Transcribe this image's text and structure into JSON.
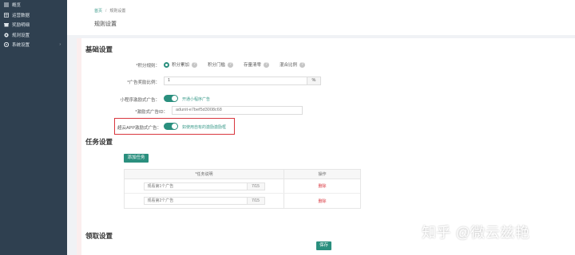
{
  "sidebar": {
    "items": [
      {
        "label": "概览",
        "icon": "list-icon"
      },
      {
        "label": "运营数据",
        "icon": "table-icon"
      },
      {
        "label": "奖励明细",
        "icon": "gift-icon"
      },
      {
        "label": "规则设置",
        "icon": "settings-icon"
      },
      {
        "label": "系统设置",
        "icon": "system-icon",
        "has_caret": true
      }
    ]
  },
  "breadcrumb": {
    "home": "首页",
    "separator": "/",
    "current": "规则设置"
  },
  "page_title": "规则设置",
  "basic": {
    "section_title": "基础设置",
    "points_rule_label": "*积分规则：",
    "points_rule_options": [
      "积分累加",
      "积分门槛",
      "存量清零",
      "混合比例"
    ],
    "points_rule_selected": "积分累加",
    "reward_ratio_label": "*广告奖励比例：",
    "reward_ratio_value": "1",
    "reward_ratio_unit": "%",
    "mini_program_label": "小程序激励式广告：",
    "mini_program_toggle_on": true,
    "mini_program_toggle_text": "开通小程序广告",
    "ad_unit_label": "*激励式广告ID：",
    "ad_unit_value": "adunit-e7bef5d3008c68",
    "app_label": "超云APP激励式广告：",
    "app_toggle_on": true,
    "app_toggle_text": "如使用自有的激励激励框"
  },
  "tasks": {
    "section_title": "任务设置",
    "add_button": "添加任务",
    "columns": [
      "*任务说明",
      "操作"
    ],
    "rows": [
      {
        "name": "观看第1个广告",
        "count": "7/15",
        "action": "删除"
      },
      {
        "name": "观看第2个广告",
        "count": "7/15",
        "action": "删除"
      }
    ]
  },
  "claim": {
    "section_title": "领取设置"
  },
  "save_button": "保存",
  "watermark": "知乎 @微云兹艳",
  "colors": {
    "sidebar_bg": "#2f4050",
    "accent": "#2a8f7e",
    "highlight": "#d9363e"
  }
}
